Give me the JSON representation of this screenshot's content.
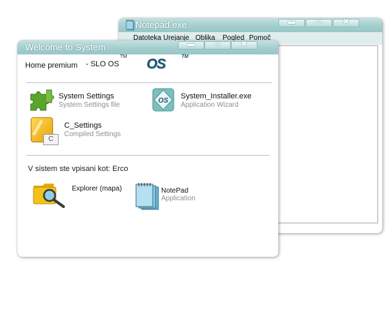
{
  "notepad": {
    "title": "Notepad.exe",
    "menu": [
      "Datoteka",
      "Urejanje",
      "Oblika",
      "Pogled",
      "Pomoč"
    ]
  },
  "welcome": {
    "title": "Welcome to System",
    "edition": "Home premium",
    "os_name": "- SLO OS",
    "tm": "TM",
    "logo_text": "OS",
    "items": [
      {
        "name": "System Settings",
        "desc": "System Settings file"
      },
      {
        "name": "System_Installer.exe",
        "desc": "Application Wizard"
      },
      {
        "name": "C_Settings",
        "desc": "Compiled Settings",
        "icon_letter": "C"
      },
      {
        "name": "Explorer (mapa)",
        "desc": ""
      },
      {
        "name": "NotePad",
        "desc": "Application"
      }
    ],
    "logged_in": "V sistem ste vpisani kot: Erco"
  },
  "colors": {
    "titlebar": "#a6cfcf",
    "accent_green": "#5aa52b",
    "folder_yellow": "#f2c21b"
  },
  "icons": [
    "puzzle-icon",
    "installer-icon",
    "settings-file-icon",
    "folder-search-icon",
    "notepad-icon"
  ]
}
